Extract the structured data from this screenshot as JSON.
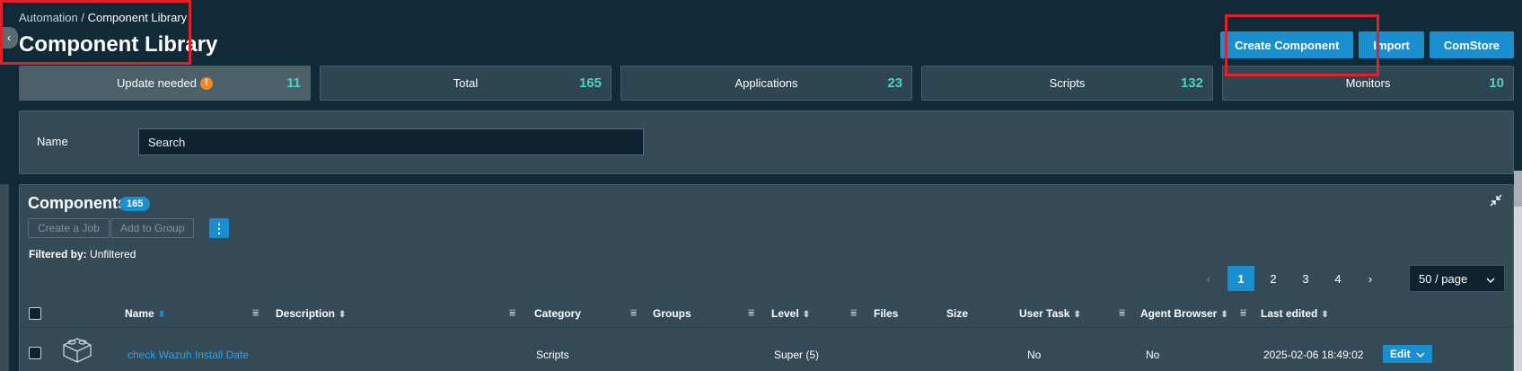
{
  "breadcrumb": {
    "parent": "Automation",
    "separator": " / ",
    "current": "Component Library"
  },
  "page_title": "Component Library",
  "header_buttons": {
    "create": "Create Component",
    "import": "Import",
    "comstore": "ComStore"
  },
  "stats": [
    {
      "label": "Update needed",
      "value": "11",
      "warning": "!"
    },
    {
      "label": "Total",
      "value": "165"
    },
    {
      "label": "Applications",
      "value": "23"
    },
    {
      "label": "Scripts",
      "value": "132"
    },
    {
      "label": "Monitors",
      "value": "10"
    }
  ],
  "filter": {
    "name_label": "Name",
    "search_placeholder": "Search"
  },
  "components": {
    "title": "Components",
    "count": "165",
    "create_job": "Create a Job",
    "add_to_group": "Add to Group",
    "menu_icon": "⋮",
    "filtered_label": "Filtered by:",
    "filtered_value": "Unfiltered"
  },
  "pagination": {
    "prev": "‹",
    "pages": [
      "1",
      "2",
      "3",
      "4"
    ],
    "next": "›",
    "per_page": "50 / page"
  },
  "table": {
    "headers": {
      "name": "Name",
      "description": "Description",
      "category": "Category",
      "groups": "Groups",
      "level": "Level",
      "files": "Files",
      "size": "Size",
      "user_task": "User Task",
      "agent_browser": "Agent Browser",
      "last_edited": "Last edited"
    },
    "rows": [
      {
        "name": "check Wazuh Install Date",
        "category": "Scripts",
        "level": "Super (5)",
        "user_task": "No",
        "agent_browser": "No",
        "last_edited": "2025-02-06 18:49:02",
        "edit_label": "Edit"
      }
    ]
  },
  "colors": {
    "accent": "#1a8fd0",
    "stat_value": "#4fd0c8",
    "warning": "#f08a24",
    "highlight": "#e0202c"
  }
}
